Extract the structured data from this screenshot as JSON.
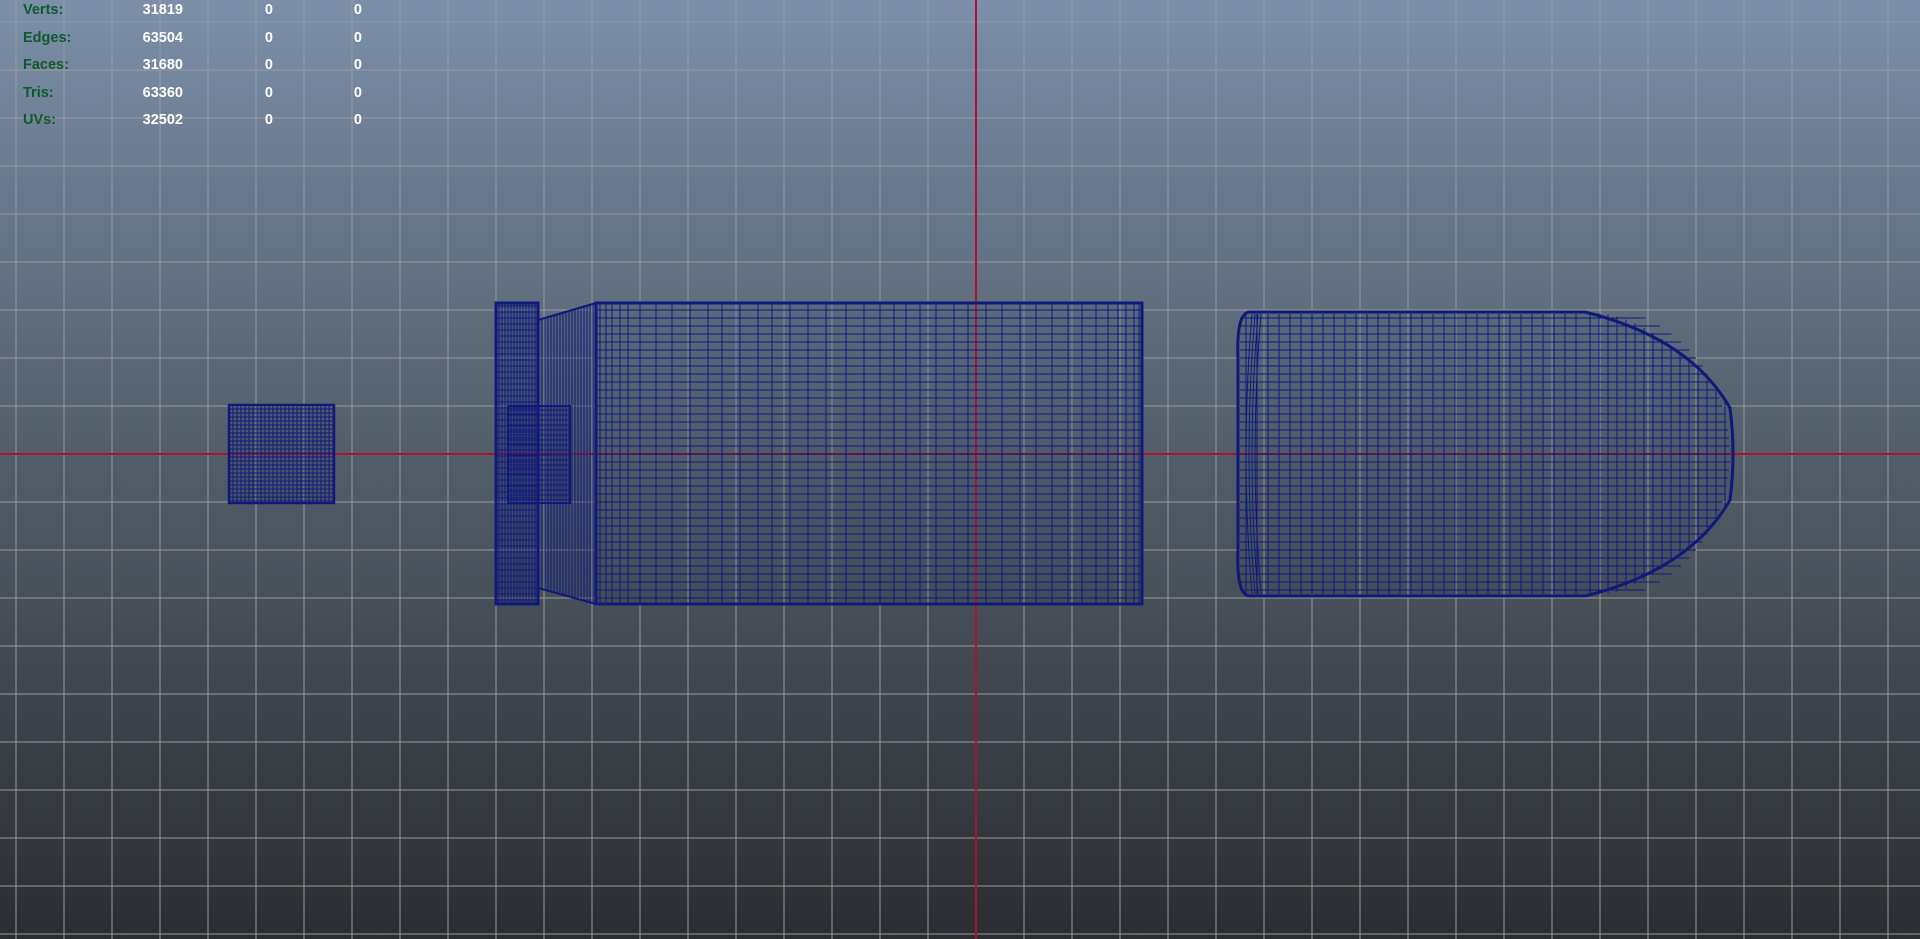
{
  "viewport": {
    "background_top": "#7c8fa9",
    "background_bottom": "#2a2d31",
    "grid_color": "#9a9a9a",
    "axis_color": "#b01030",
    "wireframe_color": "#0f1a78"
  },
  "hud": {
    "rows": [
      {
        "label": "Verts:",
        "v1": "31819",
        "v2": "0",
        "v3": "0"
      },
      {
        "label": "Edges:",
        "v1": "63504",
        "v2": "0",
        "v3": "0"
      },
      {
        "label": "Faces:",
        "v1": "31680",
        "v2": "0",
        "v3": "0"
      },
      {
        "label": "Tris:",
        "v1": "63360",
        "v2": "0",
        "v3": "0"
      },
      {
        "label": "UVs:",
        "v1": "32502",
        "v2": "0",
        "v3": "0"
      }
    ]
  },
  "scene": {
    "objects": [
      {
        "name": "primer-mesh",
        "icon": "wireframe-cube"
      },
      {
        "name": "casing-mesh",
        "icon": "wireframe-cylinder"
      },
      {
        "name": "bullet-mesh",
        "icon": "wireframe-bullet"
      }
    ]
  }
}
